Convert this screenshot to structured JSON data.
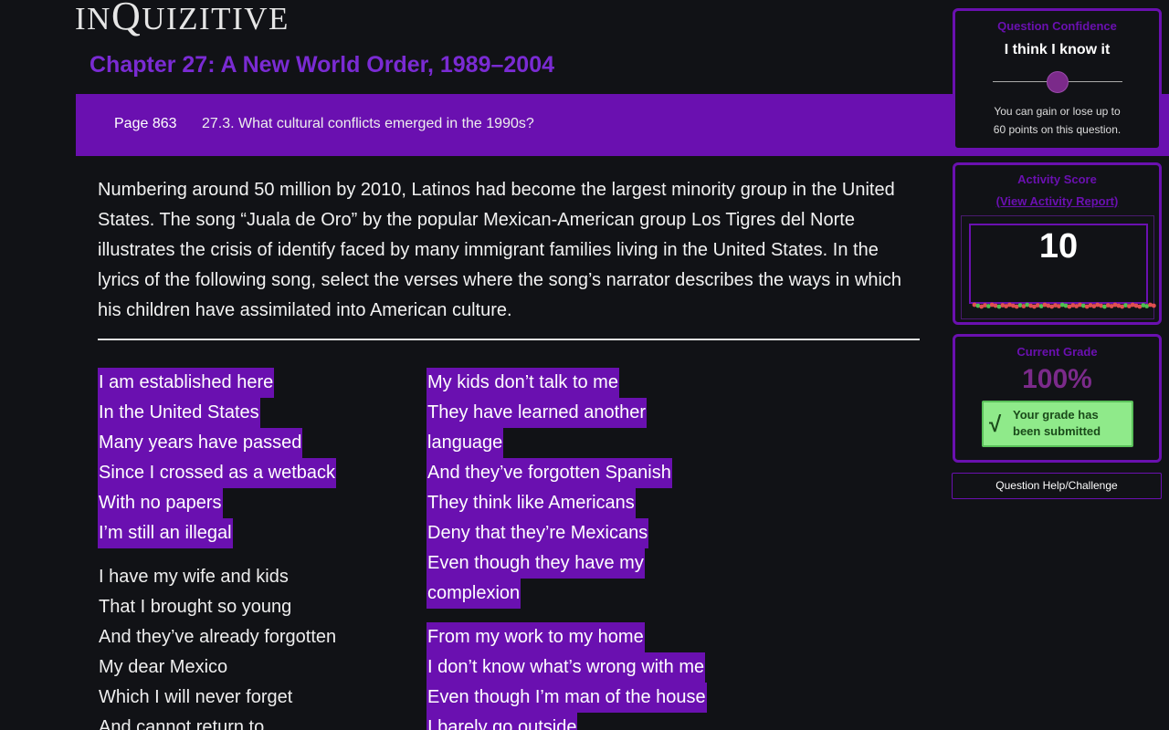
{
  "logo": {
    "prefix": "IN",
    "q": "Q",
    "suffix": "UIZITIVE"
  },
  "chapter_title": "Chapter 27: A New World Order, 1989–2004",
  "banner": {
    "page": "Page 863",
    "section": "27.3. What cultural conflicts emerged in the 1990s?"
  },
  "question": "Numbering around 50 million by 2010, Latinos had become the largest minority group in the United States. The song “Juala de Oro” by the popular Mexican-American group Los Tigres del Norte illustrates the crisis of identify faced by many immigrant families living in the United States. In the lyrics of the following song, select the verses where the song’s narrator describes the ways in which his children have assimilated into American culture.",
  "verses_left": [
    {
      "lines": [
        {
          "text": "I am established here",
          "selected": true
        },
        {
          "text": "In the United States",
          "selected": true
        },
        {
          "text": "Many years have passed",
          "selected": true
        },
        {
          "text": "Since I crossed as a wetback",
          "selected": true
        },
        {
          "text": "With no papers",
          "selected": true
        },
        {
          "text": "I’m still an illegal",
          "selected": true
        }
      ]
    },
    {
      "lines": [
        {
          "text": "I have my wife and kids",
          "selected": false
        },
        {
          "text": "That I brought so young",
          "selected": false
        },
        {
          "text": "And they’ve already forgotten",
          "selected": false
        },
        {
          "text": "My dear Mexico",
          "selected": false
        },
        {
          "text": "Which I will never forget",
          "selected": false
        },
        {
          "text": "And cannot return to",
          "selected": false
        }
      ]
    }
  ],
  "verses_right": [
    {
      "lines": [
        {
          "text": "My kids don’t talk to me",
          "selected": true
        },
        {
          "text": "They have learned another",
          "selected": true
        },
        {
          "text": "language",
          "selected": true
        },
        {
          "text": "And they’ve forgotten Spanish",
          "selected": true
        },
        {
          "text": "They think like Americans",
          "selected": true
        },
        {
          "text": "Deny that they’re Mexicans",
          "selected": true
        },
        {
          "text": "Even though they have my",
          "selected": true
        },
        {
          "text": "complexion",
          "selected": true
        }
      ]
    },
    {
      "lines": [
        {
          "text": "From my work to my home",
          "selected": true
        },
        {
          "text": "I don’t know what’s wrong with me",
          "selected": true
        },
        {
          "text": "Even though I’m man of the house",
          "selected": true
        },
        {
          "text": "I barely go outside",
          "selected": true
        }
      ]
    }
  ],
  "confidence": {
    "title": "Question Confidence",
    "value": "I think I know it",
    "slider_level": 0.5,
    "note_line1": "You can gain or lose up to",
    "note_line2": "60 points on this question."
  },
  "activity": {
    "title": "Activity Score",
    "report_link": "(View Activity Report)",
    "score": "10"
  },
  "grade": {
    "title": "Current Grade",
    "percent": "100%",
    "check": "√",
    "submitted_line1": "Your grade has",
    "submitted_line2": "been submitted"
  },
  "help_button": "Question Help/Challenge",
  "colors": {
    "accent": "#6a10b0",
    "grade": "#7b2a8a",
    "success_bg": "#8fea8a",
    "spark_red": "#e05050",
    "spark_green": "#50c050"
  }
}
